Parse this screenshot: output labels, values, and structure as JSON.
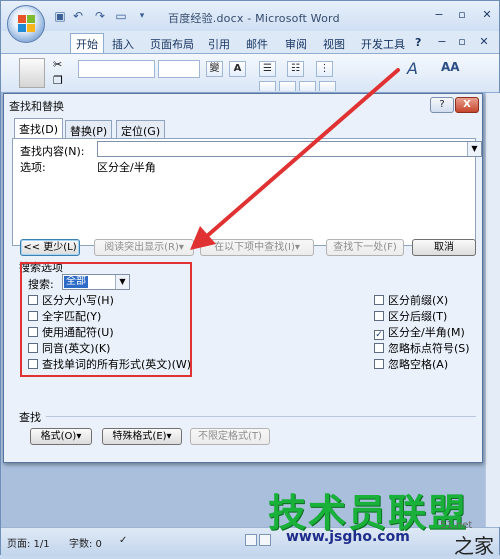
{
  "window": {
    "title": "百度经验.docx - Microsoft Word",
    "controls": [
      "−",
      "▫",
      "✕"
    ]
  },
  "quick_access": [
    "save-icon",
    "undo-icon",
    "redo-icon",
    "new-doc-icon"
  ],
  "ribbon": {
    "tabs": [
      "开始",
      "插入",
      "页面布局",
      "引用",
      "邮件",
      "审阅",
      "视图",
      "开发工具"
    ],
    "active_tab": "开始",
    "help": "?",
    "icons": [
      "paste-icon",
      "cut-icon",
      "copy-icon",
      "font-format-icon",
      "bullets-icon",
      "numbering-icon",
      "styles-icon",
      "find-icon"
    ],
    "font_buttons": [
      "變",
      "A"
    ],
    "style_icon_label": "A",
    "find_icon_label": "AA"
  },
  "dialog": {
    "title": "查找和替换",
    "help": "?",
    "close": "X",
    "tabs": [
      "查找(D)",
      "替换(P)",
      "定位(G)"
    ],
    "active_tab": "查找(D)",
    "find_label": "查找内容(N):",
    "find_value": "",
    "options_label": "选项:",
    "options_value": "区分全/半角",
    "buttons": {
      "less": "<< 更少(L)",
      "reading_highlight": "阅读突出显示(R)▾",
      "find_in": "在以下项中查找(I)▾",
      "find_next": "查找下一处(F)",
      "cancel": "取消"
    },
    "search_options": {
      "label": "搜索选项",
      "direction_label": "搜索:",
      "direction_value": "全部",
      "left": [
        {
          "label": "区分大小写(H)",
          "checked": false
        },
        {
          "label": "全字匹配(Y)",
          "checked": false
        },
        {
          "label": "使用通配符(U)",
          "checked": false
        },
        {
          "label": "同音(英文)(K)",
          "checked": false
        },
        {
          "label": "查找单词的所有形式(英文)(W)",
          "checked": false
        }
      ],
      "right": [
        {
          "label": "区分前缀(X)",
          "checked": false
        },
        {
          "label": "区分后缀(T)",
          "checked": false
        },
        {
          "label": "区分全/半角(M)",
          "checked": true
        },
        {
          "label": "忽略标点符号(S)",
          "checked": false
        },
        {
          "label": "忽略空格(A)",
          "checked": false
        }
      ]
    },
    "find_section": {
      "label": "查找",
      "format": "格式(O)▾",
      "special": "特殊格式(E)▾",
      "no_format": "不限定格式(T)"
    }
  },
  "status_bar": {
    "page": "页面: 1/1",
    "words": "字数: 0"
  },
  "watermark": {
    "main": "技术员联盟",
    "url": "www.jsgho.com",
    "side": "51.net",
    "zhi": "之家"
  },
  "colors": {
    "annotation": "#e03232",
    "watermark_green": "#19b13a",
    "watermark_blue": "#1e2c8a"
  }
}
